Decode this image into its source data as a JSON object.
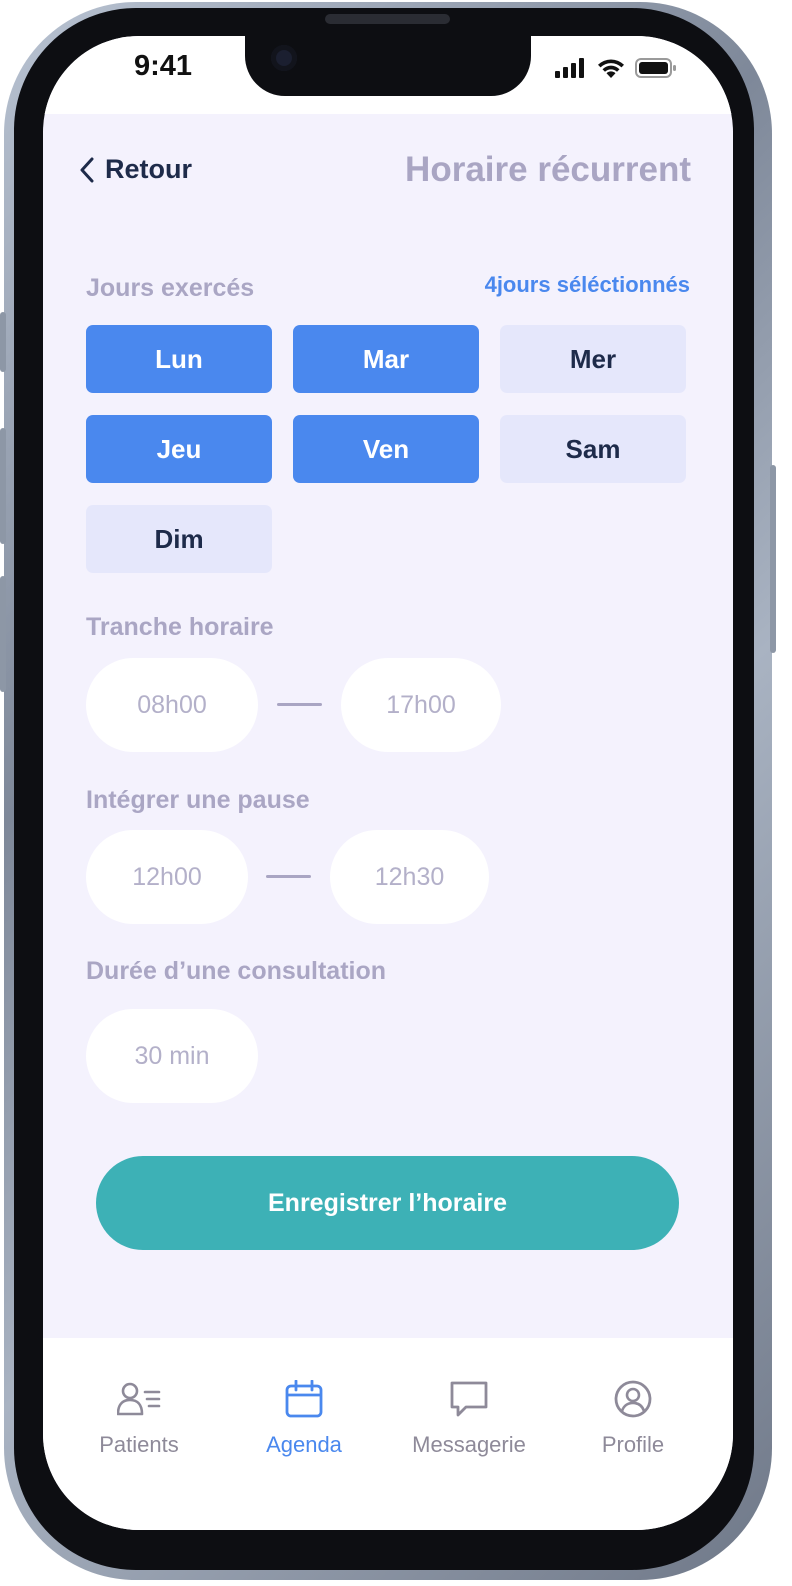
{
  "status_bar": {
    "time": "9:41"
  },
  "header": {
    "back_label": "Retour",
    "title": "Horaire récurrent"
  },
  "days_section": {
    "label": "Jours exercés",
    "selection_count": "4jours séléctionnés",
    "days": [
      {
        "label": "Lun",
        "selected": true
      },
      {
        "label": "Mar",
        "selected": true
      },
      {
        "label": "Mer",
        "selected": false
      },
      {
        "label": "Jeu",
        "selected": true
      },
      {
        "label": "Ven",
        "selected": true
      },
      {
        "label": "Sam",
        "selected": false
      },
      {
        "label": "Dim",
        "selected": false
      }
    ]
  },
  "time_range": {
    "label": "Tranche horaire",
    "start": "08h00",
    "end": "17h00"
  },
  "pause": {
    "label": "Intégrer une pause",
    "start": "12h00",
    "end": "12h30"
  },
  "consultation": {
    "label": "Durée d’une consultation",
    "duration": "30 min"
  },
  "save_button": {
    "label": "Enregistrer l’horaire"
  },
  "tab_bar": {
    "tabs": [
      {
        "label": "Patients",
        "icon": "patients-icon",
        "active": false
      },
      {
        "label": "Agenda",
        "icon": "calendar-icon",
        "active": true
      },
      {
        "label": "Messagerie",
        "icon": "chat-bubble-icon",
        "active": false
      },
      {
        "label": "Profile",
        "icon": "user-circle-icon",
        "active": false
      }
    ]
  },
  "colors": {
    "accent_blue": "#4a88ee",
    "teal": "#3db1b6",
    "screen_bg": "#f4f2fd",
    "muted_label": "#aaa6c4",
    "dark_text": "#1e2b4a"
  }
}
